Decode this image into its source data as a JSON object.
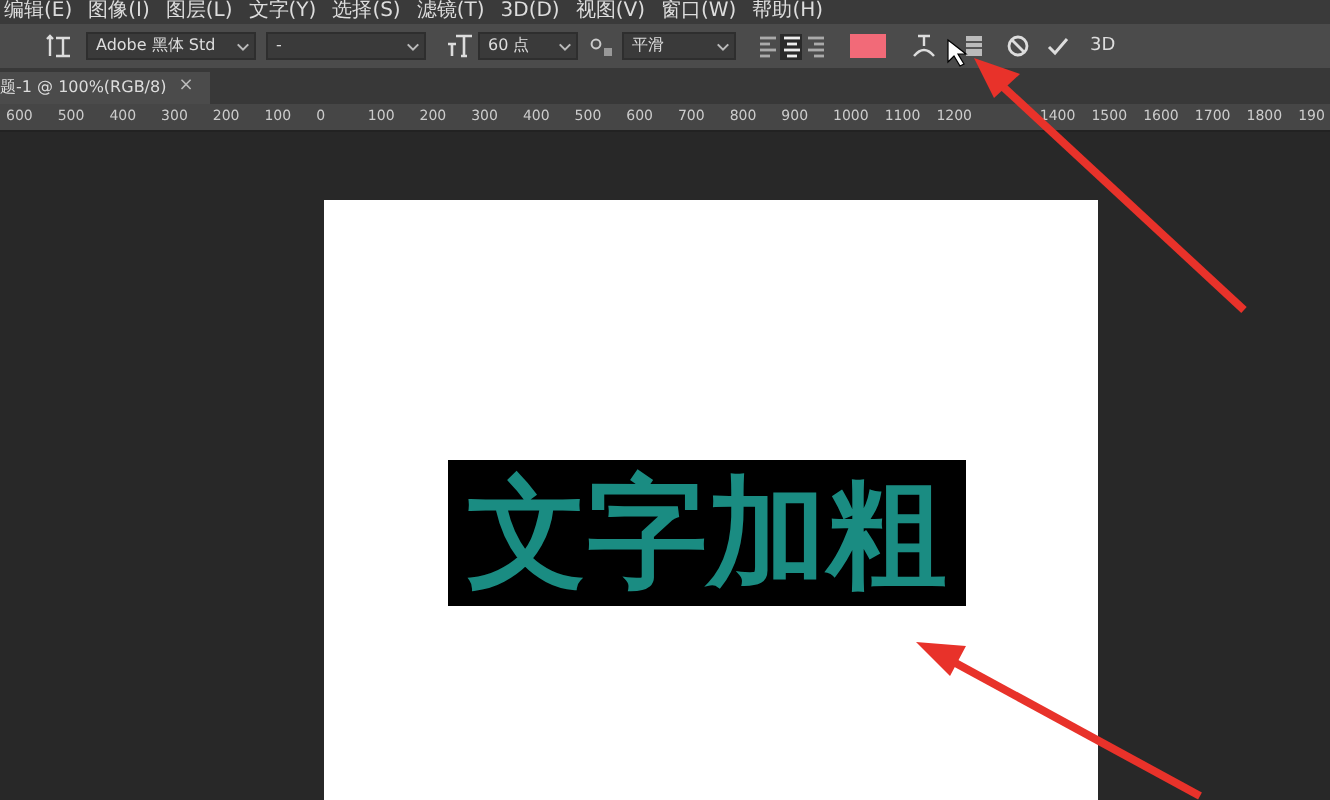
{
  "menu_bar": {
    "items": [
      "编辑(E)",
      "图像(I)",
      "图层(L)",
      "文字(Y)",
      "选择(S)",
      "滤镜(T)",
      "3D(D)",
      "视图(V)",
      "窗口(W)",
      "帮助(H)"
    ]
  },
  "options_bar": {
    "font_family": "Adobe 黑体 Std",
    "font_style": "-",
    "font_size": "60 点",
    "antialias": "平滑",
    "alignment": [
      {
        "selected": false
      },
      {
        "selected": true
      },
      {
        "selected": false
      }
    ],
    "commit_button": "3D"
  },
  "document_tab": {
    "title": "题-1 @ 100%(RGB/8)",
    "close": "×"
  },
  "ruler": {
    "labels_before_arrow": [
      "600",
      "500",
      "400",
      "300",
      "200",
      "100",
      "0",
      "100",
      "200",
      "300",
      "400",
      "500",
      "600",
      "700",
      "800",
      "900",
      "1000",
      "1100",
      "1200"
    ],
    "labels_after_arrow": [
      "1400",
      "1500",
      "1600",
      "1700",
      "1800",
      "190"
    ]
  },
  "canvas": {
    "text": "文字加粗"
  }
}
